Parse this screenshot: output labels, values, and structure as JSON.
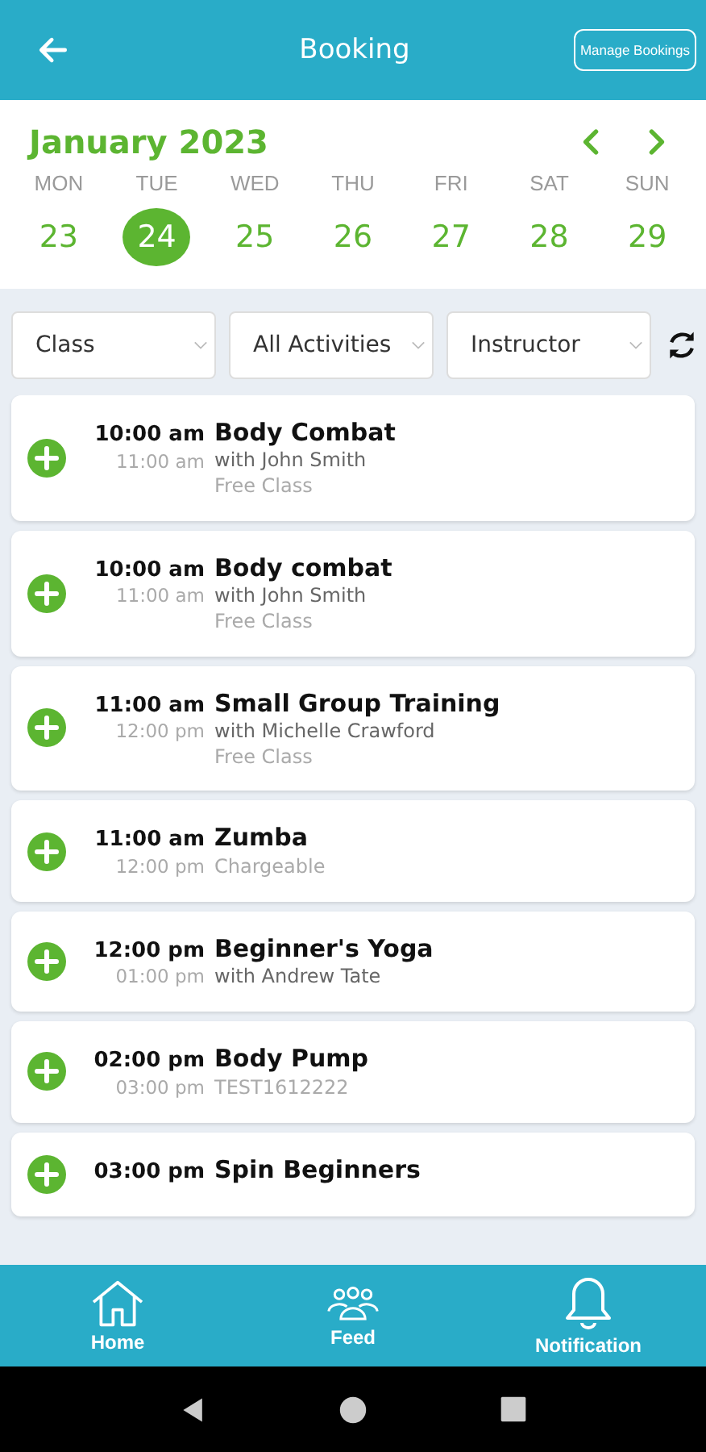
{
  "header": {
    "title": "Booking",
    "action": "Manage Bookings"
  },
  "calendar": {
    "month": "January 2023",
    "days": [
      {
        "weekday": "MON",
        "date": "23",
        "selected": false
      },
      {
        "weekday": "TUE",
        "date": "24",
        "selected": true
      },
      {
        "weekday": "WED",
        "date": "25",
        "selected": false
      },
      {
        "weekday": "THU",
        "date": "26",
        "selected": false
      },
      {
        "weekday": "FRI",
        "date": "27",
        "selected": false
      },
      {
        "weekday": "SAT",
        "date": "28",
        "selected": false
      },
      {
        "weekday": "SUN",
        "date": "29",
        "selected": false
      }
    ]
  },
  "filters": [
    "Class",
    "All Activities",
    "Instructor"
  ],
  "classes": [
    {
      "start": "10:00 am",
      "end": "11:00 am",
      "name": "Body Combat",
      "instructor": "with John Smith",
      "note": "Free Class"
    },
    {
      "start": "10:00 am",
      "end": "11:00 am",
      "name": "Body combat",
      "instructor": "with John Smith",
      "note": "Free Class"
    },
    {
      "start": "11:00 am",
      "end": "12:00 pm",
      "name": "Small Group Training",
      "instructor": "with Michelle Crawford",
      "note": "Free Class"
    },
    {
      "start": "11:00 am",
      "end": "12:00 pm",
      "name": "Zumba",
      "note": "Chargeable"
    },
    {
      "start": "12:00 pm",
      "end": "01:00 pm",
      "name": "Beginner's Yoga",
      "instructor": "with Andrew Tate"
    },
    {
      "start": "02:00 pm",
      "end": "03:00 pm",
      "name": "Body Pump",
      "note": "TEST1612222"
    },
    {
      "start": "03:00 pm",
      "name": "Spin Beginners"
    }
  ],
  "nav": [
    {
      "label": "Home",
      "kind": "home"
    },
    {
      "label": "Feed",
      "kind": "feed"
    },
    {
      "label": "Notification",
      "kind": "bell"
    }
  ]
}
